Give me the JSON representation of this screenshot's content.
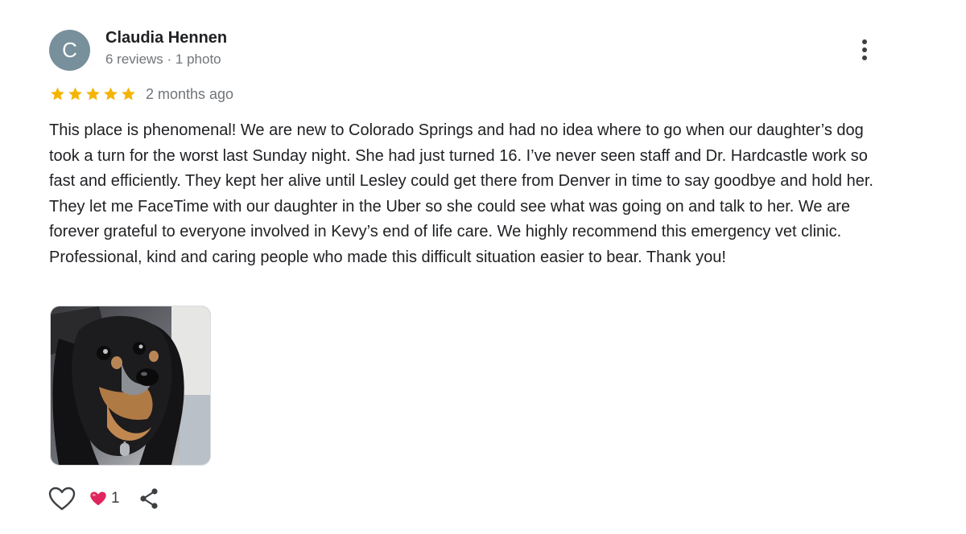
{
  "author": {
    "initial": "C",
    "name": "Claudia Hennen",
    "meta": "6 reviews · 1 photo",
    "avatar_color": "#78909c"
  },
  "review": {
    "rating": 5,
    "rating_max": 5,
    "date": "2 months ago",
    "text": "This place is phenomenal! We are new to Colorado Springs and had no idea where to go when our daughter’s dog took a turn for the worst last Sunday night. She had just turned 16. I’ve never seen staff and Dr. Hardcastle work so fast and efficiently. They kept her alive until Lesley could get there from Denver in time to say goodbye and hold her. They let me FaceTime with our daughter in the Uber so she could see what was going on and talk to her. We are forever grateful to everyone involved in Kevy’s end of life care. We highly recommend this emergency vet clinic. Professional, kind and caring people who made this difficult situation easier to bear. Thank you!"
  },
  "actions": {
    "like_icon": "heart-outline-icon",
    "reaction_icon": "red-heart-icon",
    "reaction_count": "1",
    "share_icon": "share-icon",
    "more_icon": "more-vertical-icon"
  },
  "colors": {
    "star": "#f4b400",
    "reaction": "#e0245e",
    "text": "#202124",
    "muted": "#70757a"
  }
}
